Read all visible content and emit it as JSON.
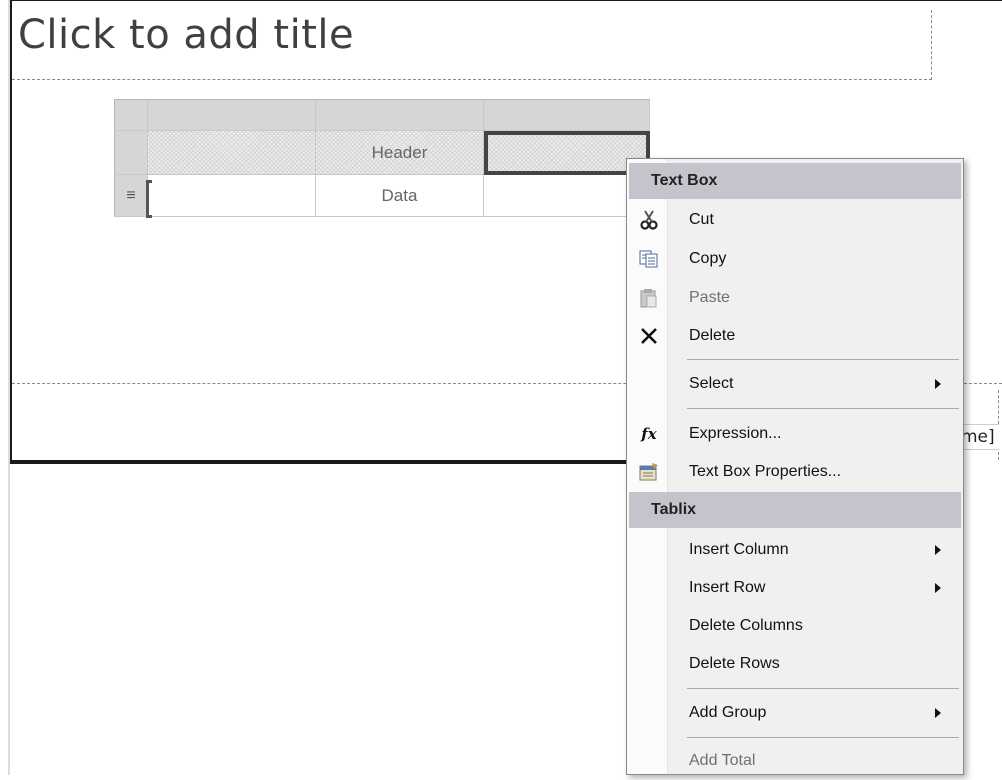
{
  "report": {
    "title_placeholder": "Click to add title",
    "footer_fragment": "me]"
  },
  "tablix": {
    "header_cells": [
      "",
      "Header",
      ""
    ],
    "data_cells": [
      "",
      "Data",
      ""
    ],
    "row_handle_icon": "row-lines-icon"
  },
  "context_menu": {
    "sections": [
      {
        "header": "Text Box",
        "items": [
          {
            "label": "Cut",
            "icon": "scissors-icon",
            "enabled": true
          },
          {
            "label": "Copy",
            "icon": "copy-icon",
            "enabled": true
          },
          {
            "label": "Paste",
            "icon": "paste-icon",
            "enabled": false
          },
          {
            "label": "Delete",
            "icon": "delete-x-icon",
            "enabled": true
          },
          {
            "label": "Select",
            "submenu": true,
            "enabled": true
          },
          {
            "label": "Expression...",
            "icon": "fx-icon",
            "enabled": true
          },
          {
            "label": "Text Box Properties...",
            "icon": "properties-icon",
            "enabled": true
          }
        ]
      },
      {
        "header": "Tablix",
        "items": [
          {
            "label": "Insert Column",
            "submenu": true,
            "enabled": true
          },
          {
            "label": "Insert Row",
            "submenu": true,
            "enabled": true
          },
          {
            "label": "Delete Columns",
            "enabled": true
          },
          {
            "label": "Delete Rows",
            "enabled": true
          },
          {
            "label": "Add Group",
            "submenu": true,
            "enabled": true
          },
          {
            "label": "Add Total",
            "enabled": false
          }
        ]
      }
    ]
  },
  "colors": {
    "menu_header_bg": "#c4c4cc",
    "menu_bg": "#f0f0f0",
    "selection_border": "#444444"
  }
}
